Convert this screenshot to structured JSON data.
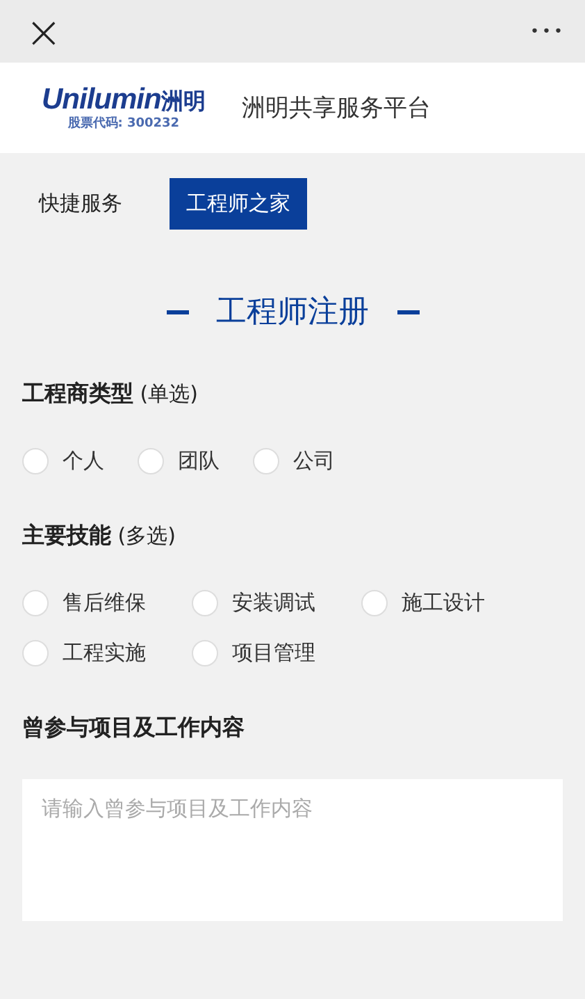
{
  "top_bar": {
    "close": "×",
    "more": "•••"
  },
  "header": {
    "logo": {
      "brand": "Unilumin",
      "brand_cn": "洲明",
      "stock": "股票代码: 300232"
    },
    "title": "洲明共享服务平台"
  },
  "tabs": [
    {
      "label": "快捷服务",
      "selected": false
    },
    {
      "label": "工程师之家",
      "selected": true
    }
  ],
  "page_title": "工程师注册",
  "sections": [
    {
      "kind": "radio",
      "heading": "**工程商类型** (单选)",
      "options": [
        {
          "label": "个人",
          "checked": false
        },
        {
          "label": "团队",
          "checked": false
        },
        {
          "label": "公司",
          "checked": false
        }
      ]
    },
    {
      "kind": "checkbox",
      "heading": "**主要技能** (多选)",
      "options": [
        {
          "label": "售后维保",
          "checked": false
        },
        {
          "label": "安装调试",
          "checked": false
        },
        {
          "label": "施工设计",
          "checked": false
        },
        {
          "label": "工程实施",
          "checked": false
        },
        {
          "label": "项目管理",
          "checked": false
        }
      ]
    },
    {
      "kind": "textarea",
      "heading": "**曾参与项目及工作内容**",
      "placeholder": "请输入曾参与项目及工作内容"
    }
  ]
}
